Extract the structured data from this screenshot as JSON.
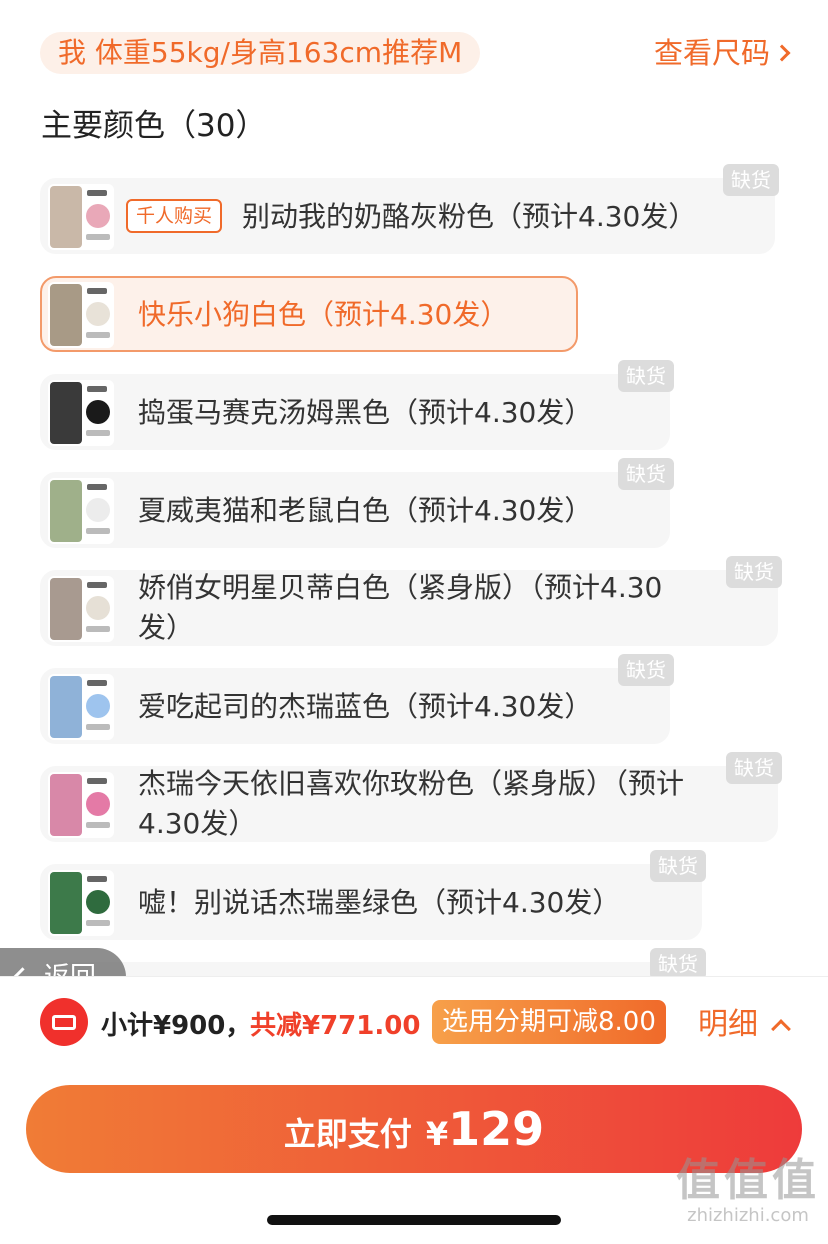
{
  "recommendation": "我 体重55kg/身高163cm推荐M",
  "size_chart_link": "查看尺码",
  "section_title": "主要颜色（30）",
  "colors": {
    "accent": "#f06a2a",
    "danger": "#f0302c",
    "oos_badge": "#dcdcdc"
  },
  "options": [
    {
      "label": "别动我的奶酪灰粉色（预计4.30发）",
      "badge": "千人购买",
      "oos": "缺货",
      "selected": false,
      "fig_color": "#c9b8a8",
      "ball_color": "#e9a8b8"
    },
    {
      "label": "快乐小狗白色（预计4.30发）",
      "badge": "",
      "oos": "",
      "selected": true,
      "fig_color": "#a89a86",
      "ball_color": "#e8e2d8"
    },
    {
      "label": "捣蛋马赛克汤姆黑色（预计4.30发）",
      "badge": "",
      "oos": "缺货",
      "selected": false,
      "fig_color": "#3a3a3a",
      "ball_color": "#1a1a1a"
    },
    {
      "label": "夏威夷猫和老鼠白色（预计4.30发）",
      "badge": "",
      "oos": "缺货",
      "selected": false,
      "fig_color": "#9fb08a",
      "ball_color": "#ececec"
    },
    {
      "label_line1": "娇俏女明星贝蒂白色（紧身版）（预计4.30",
      "label_line2": "发）",
      "badge": "",
      "oos": "缺货",
      "selected": false,
      "fig_color": "#a89a90",
      "ball_color": "#e6e0d6"
    },
    {
      "label": "爱吃起司的杰瑞蓝色（预计4.30发）",
      "badge": "",
      "oos": "缺货",
      "selected": false,
      "fig_color": "#8fb2d8",
      "ball_color": "#9ec4ee"
    },
    {
      "label_line1": "杰瑞今天依旧喜欢你玫粉色（紧身版）（预计",
      "label_line2": "4.30发）",
      "badge": "",
      "oos": "缺货",
      "selected": false,
      "fig_color": "#d888a8",
      "ball_color": "#e47aa6"
    },
    {
      "label": "嘘！别说话杰瑞墨绿色（预计4.30发）",
      "badge": "",
      "oos": "缺货",
      "selected": false,
      "fig_color": "#3d7a4a",
      "ball_color": "#2f6b3e"
    },
    {
      "label": "",
      "badge": "",
      "oos": "缺货",
      "selected": false
    }
  ],
  "back_button": "返回",
  "footer": {
    "subtotal": "小计¥900，",
    "discount": "共减¥771.00",
    "installment": "选用分期可减8.00",
    "details": "明细"
  },
  "pay_button": {
    "label": "立即支付",
    "currency": "¥",
    "amount": "129"
  },
  "watermark": {
    "logo": "值值值",
    "url": "zhizhizhi.com"
  }
}
